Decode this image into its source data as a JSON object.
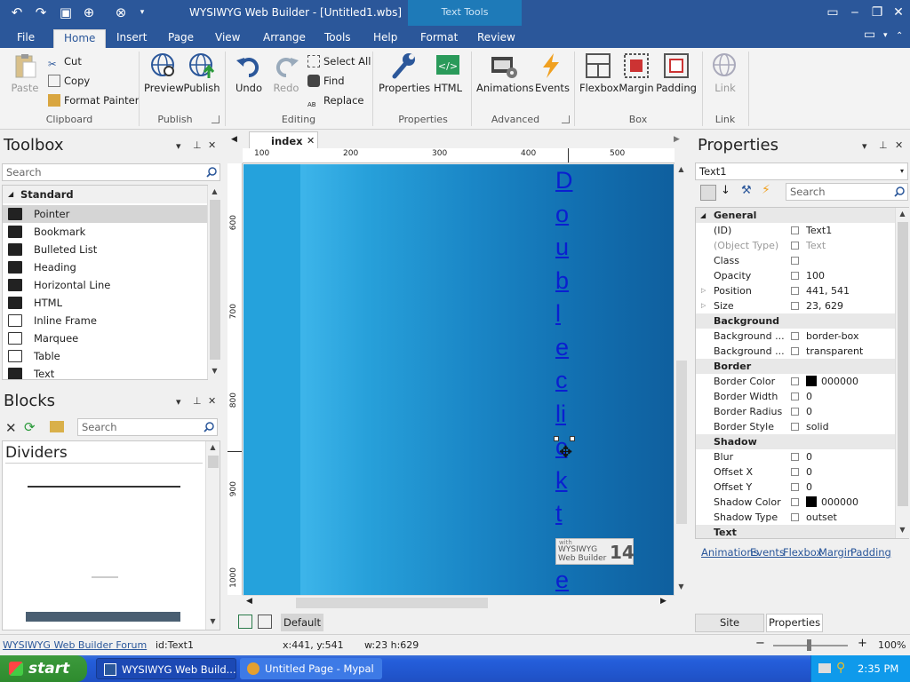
{
  "window": {
    "title": "WYSIWYG Web Builder - [Untitled1.wbs]",
    "context_tab": "Text Tools"
  },
  "ribbon_tabs": [
    "File",
    "Home",
    "Insert",
    "Page",
    "View",
    "Arrange",
    "Tools",
    "Help",
    "Format",
    "Review"
  ],
  "ribbon": {
    "clipboard": {
      "paste": "Paste",
      "cut": "Cut",
      "copy": "Copy",
      "format_painter": "Format Painter",
      "label": "Clipboard"
    },
    "publish": {
      "preview": "Preview",
      "publish": "Publish",
      "label": "Publish"
    },
    "editing": {
      "undo": "Undo",
      "redo": "Redo",
      "select_all": "Select All",
      "find": "Find",
      "replace": "Replace",
      "label": "Editing"
    },
    "properties": {
      "properties": "Properties",
      "html": "HTML",
      "label": "Properties"
    },
    "advanced": {
      "animations": "Animations",
      "events": "Events",
      "label": "Advanced"
    },
    "box": {
      "flexbox": "Flexbox",
      "margin": "Margin",
      "padding": "Padding",
      "label": "Box"
    },
    "link": {
      "link": "Link",
      "label": "Link"
    }
  },
  "toolbox": {
    "title": "Toolbox",
    "search_placeholder": "Search",
    "category": "Standard",
    "items": [
      "Pointer",
      "Bookmark",
      "Bulleted List",
      "Heading",
      "Horizontal Line",
      "HTML",
      "Inline Frame",
      "Marquee",
      "Table",
      "Text"
    ]
  },
  "blocks": {
    "title": "Blocks",
    "search_placeholder": "Search",
    "section": "Dividers"
  },
  "editor": {
    "tab": "index",
    "ruler_h": [
      "100",
      "200",
      "300",
      "400",
      "500"
    ],
    "ruler_v": [
      "600",
      "700",
      "800",
      "900",
      "1000"
    ],
    "vertical_text": [
      "D",
      "o",
      "u",
      "b",
      "l",
      "e",
      "c",
      "li",
      "c",
      "k",
      "t",
      "o",
      "e"
    ],
    "badge_line1": "with",
    "badge_line2": "WYSIWYG",
    "badge_line3": "Web Builder",
    "badge_number": "14",
    "bottom_tab": "Default"
  },
  "properties": {
    "title": "Properties",
    "selected": "Text1",
    "search_placeholder": "Search",
    "rows": [
      {
        "type": "cat",
        "name": "General"
      },
      {
        "name": "(ID)",
        "value": "Text1"
      },
      {
        "name": "(Object Type)",
        "value": "Text"
      },
      {
        "name": "Class",
        "value": ""
      },
      {
        "name": "Opacity",
        "value": "100"
      },
      {
        "name": "Position",
        "value": "441, 541"
      },
      {
        "name": "Size",
        "value": "23, 629"
      },
      {
        "type": "cat",
        "name": "Background"
      },
      {
        "name": "Background ...",
        "value": "border-box"
      },
      {
        "name": "Background ...",
        "value": "transparent"
      },
      {
        "type": "cat",
        "name": "Border"
      },
      {
        "name": "Border Color",
        "value": "000000",
        "swatch": "#000000"
      },
      {
        "name": "Border Width",
        "value": "0"
      },
      {
        "name": "Border Radius",
        "value": "0"
      },
      {
        "name": "Border Style",
        "value": "solid"
      },
      {
        "type": "cat",
        "name": "Shadow"
      },
      {
        "name": "Blur",
        "value": "0"
      },
      {
        "name": "Offset X",
        "value": "0"
      },
      {
        "name": "Offset Y",
        "value": "0"
      },
      {
        "name": "Shadow Color",
        "value": "000000",
        "swatch": "#000000"
      },
      {
        "name": "Shadow Type",
        "value": "outset"
      },
      {
        "type": "cat",
        "name": "Text"
      }
    ],
    "links": [
      "Animations",
      "Events",
      "Flexbox",
      "Margin",
      "Padding"
    ],
    "bottom_tabs": [
      "Site Manager",
      "Properties"
    ]
  },
  "status": {
    "forum_link": "WYSIWYG Web Builder Forum",
    "id": "id:Text1",
    "pos": "x:441, y:541",
    "size": "w:23 h:629",
    "zoom": "100%"
  },
  "taskbar": {
    "start": "start",
    "tasks": [
      "WYSIWYG Web Build...",
      "Untitled Page - Mypal"
    ],
    "clock": "2:35 PM"
  },
  "colors": {
    "accent": "#2b579a",
    "page_blue": "#1a86c6",
    "link_text": "#0a1fd0"
  }
}
